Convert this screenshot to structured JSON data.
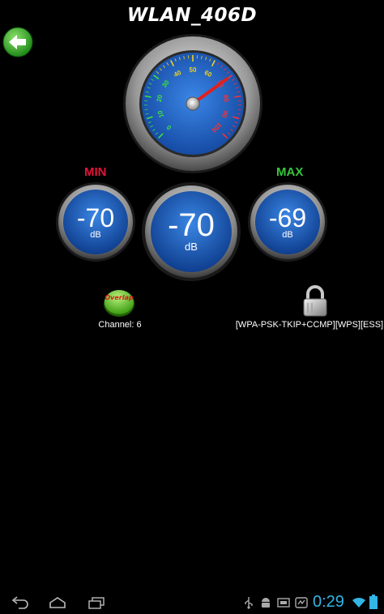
{
  "header": {
    "title": "WLAN_406D"
  },
  "gauge": {
    "ticks": [
      "0",
      "10",
      "20",
      "30",
      "40",
      "50",
      "60",
      "70",
      "80",
      "90",
      "100"
    ],
    "needle_value": 70
  },
  "signal": {
    "min_label": "MIN",
    "max_label": "MAX",
    "min_value": "-70",
    "current_value": "-70",
    "max_value": "-69",
    "unit": "dB"
  },
  "network": {
    "overlap_label": "Overlap",
    "channel_text": "Channel: 6",
    "security_text": "[WPA-PSK-TKIP+CCMP][WPS][ESS]"
  },
  "statusbar": {
    "time": "0:29"
  },
  "colors": {
    "min": "#e5123b",
    "max": "#37c63c",
    "dial": "#1d5fbf",
    "clock": "#33b5e5"
  }
}
